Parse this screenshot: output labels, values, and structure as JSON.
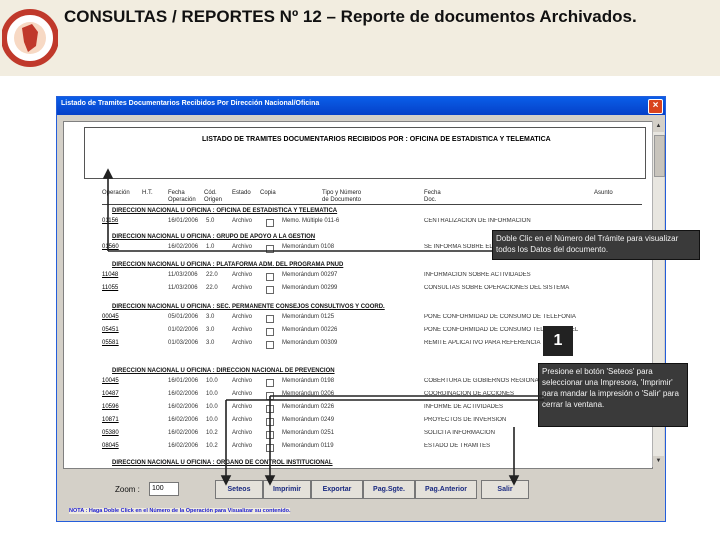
{
  "slide": {
    "title": "CONSULTAS / REPORTES Nº 12 – Reporte de documentos Archivados."
  },
  "window": {
    "title": "Listado de Tramites Documentarios Recibidos Por Dirección Nacional/Oficina",
    "close_glyph": "×"
  },
  "report": {
    "title": "LISTADO DE TRAMITES DOCUMENTARIOS RECIBIDOS POR :  OFICINA DE ESTADISTICA Y TELEMATICA",
    "columns": [
      "Operación",
      "H.T.",
      "Fecha Operación",
      "Cód. Origen",
      "Estado",
      "Copia",
      "Tipo y Número de Documento",
      "Fecha Doc.",
      "Asunto"
    ],
    "sections": [
      {
        "label": "DIRECCION NACIONAL U OFICINA :  OFICINA DE ESTADISTICA Y TELEMATICA"
      },
      {
        "label": "DIRECCION NACIONAL U OFICINA :  GRUPO DE APOYO A LA GESTION"
      },
      {
        "label": "DIRECCION NACIONAL U OFICINA :  PLATAFORMA ADM. DEL PROGRAMA PNUD"
      },
      {
        "label": "DIRECCION NACIONAL U OFICINA :  SEC. PERMANENTE CONSEJOS CONSULTIVOS Y COORD."
      },
      {
        "label": "DIRECCION NACIONAL U OFICINA :  DIRECCION NACIONAL DE PREVENCION"
      },
      {
        "label": "DIRECCION NACIONAL U OFICINA :  ORGANO DE CONTROL INSTITUCIONAL"
      }
    ],
    "rows": [
      {
        "num": "01156",
        "date": "16/01/2006",
        "cod": "5.0",
        "estado": "Archivo",
        "doc": "Memo. Múltiple 011-6",
        "desc": "CENTRALIZACION DE INFORMACION"
      },
      {
        "num": "01560",
        "date": "16/02/2006",
        "cod": "1.0",
        "estado": "Archivo",
        "doc": "Memorándum 0108",
        "desc": "SE INFORMA SOBRE EL PLAN DE SUPERVISION"
      },
      {
        "num": "11048",
        "date": "11/03/2006",
        "cod": "22.0",
        "estado": "Archivo",
        "doc": "Memorándum 00297",
        "desc": "INFORMACION SOBRE ACTIVIDADES"
      },
      {
        "num": "11055",
        "date": "11/03/2006",
        "cod": "22.0",
        "estado": "Archivo",
        "doc": "Memorándum 00299",
        "desc": "CONSULTAS SOBRE OPERACIONES DEL SISTEMA"
      },
      {
        "num": "00045",
        "date": "05/01/2006",
        "cod": "3.0",
        "estado": "Archivo",
        "doc": "Memorándum 0125",
        "desc": "PONE CONFORMIDAD DE CONSUMO DE TELEFONIA"
      },
      {
        "num": "05451",
        "date": "01/02/2006",
        "cod": "3.0",
        "estado": "Archivo",
        "doc": "Memorándum 00226",
        "desc": "PONE CONFORMIDAD DE CONSUMO TELEFONO CEL"
      },
      {
        "num": "05581",
        "date": "01/03/2006",
        "cod": "3.0",
        "estado": "Archivo",
        "doc": "Memorándum 00309",
        "desc": "REMITE APLICATIVO PARA REFERENCIA"
      },
      {
        "num": "10045",
        "date": "16/01/2006",
        "cod": "10.0",
        "estado": "Archivo",
        "doc": "Memorándum 0198",
        "desc": "COBERTURA DE GOBIERNOS REGIONALES"
      },
      {
        "num": "10487",
        "date": "16/02/2006",
        "cod": "10.0",
        "estado": "Archivo",
        "doc": "Memorándum 0206",
        "desc": "COORDINACION DE ACCIONES"
      },
      {
        "num": "10596",
        "date": "16/02/2006",
        "cod": "10.0",
        "estado": "Archivo",
        "doc": "Memorándum 0226",
        "desc": "INFORME DE ACTIVIDADES"
      },
      {
        "num": "10871",
        "date": "16/02/2006",
        "cod": "10.0",
        "estado": "Archivo",
        "doc": "Memorándum 0249",
        "desc": "PROYECTOS DE INVERSION"
      },
      {
        "num": "05380",
        "date": "16/02/2006",
        "cod": "10.2",
        "estado": "Archivo",
        "doc": "Memorándum 0251",
        "desc": "SOLICITA INFORMACION"
      },
      {
        "num": "08045",
        "date": "16/02/2006",
        "cod": "10.2",
        "estado": "Archivo",
        "doc": "Memorándum 0119",
        "desc": "ESTADO DE TRAMITES"
      }
    ]
  },
  "controls": {
    "zoom_label": "Zoom :",
    "zoom_value": "100",
    "buttons": [
      "Seteos",
      "Imprimir",
      "Exportar",
      "Pag.Sgte.",
      "Pag.Anterior",
      "Salir"
    ],
    "nota": "NOTA : Haga Doble Click en el Número de la Operación para Visualizar su contenido."
  },
  "callouts": {
    "doble_clic": "Doble Clic en el Número del Trámite para visualizar todos los Datos del documento.",
    "marker": "1",
    "botones": "Presione el botón 'Seteos' para seleccionar una Impresora, 'Imprimir' para mandar la impresión o 'Salir' para cerrar la ventana."
  },
  "colors": {
    "titlebar": "#0a5ee8",
    "callout_bg": "#3a3a3a",
    "button_text": "#1a2a80",
    "nota_text": "#1a1ad0"
  }
}
